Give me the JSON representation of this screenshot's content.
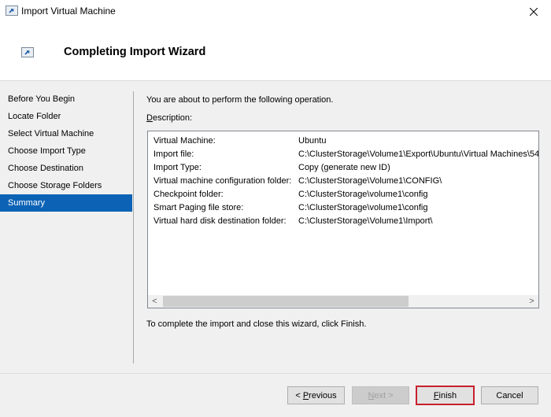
{
  "window": {
    "title": "Import Virtual Machine",
    "icon": "import-vm-icon",
    "close_icon": "close-icon"
  },
  "header": {
    "title": "Completing Import Wizard",
    "icon": "import-vm-icon"
  },
  "sidebar": {
    "items": [
      {
        "label": "Before You Begin",
        "active": false
      },
      {
        "label": "Locate Folder",
        "active": false
      },
      {
        "label": "Select Virtual Machine",
        "active": false
      },
      {
        "label": "Choose Import Type",
        "active": false
      },
      {
        "label": "Choose Destination",
        "active": false
      },
      {
        "label": "Choose Storage Folders",
        "active": false
      },
      {
        "label": "Summary",
        "active": true
      }
    ],
    "active_color": "#0c63b6"
  },
  "main": {
    "intro": "You are about to perform the following operation.",
    "description_label_accel": "D",
    "description_label_rest": "escription:",
    "description_rows": [
      {
        "key": "Virtual Machine:",
        "value": "Ubuntu"
      },
      {
        "key": "Import file:",
        "value": "C:\\ClusterStorage\\Volume1\\Export\\Ubuntu\\Virtual Machines\\54"
      },
      {
        "key": "Import Type:",
        "value": "Copy (generate new ID)"
      },
      {
        "key": "Virtual machine configuration folder:",
        "value": "C:\\ClusterStorage\\Volume1\\CONFIG\\"
      },
      {
        "key": "Checkpoint folder:",
        "value": "C:\\ClusterStorage\\volume1\\config"
      },
      {
        "key": "Smart Paging file store:",
        "value": "C:\\ClusterStorage\\volume1\\config"
      },
      {
        "key": "Virtual hard disk destination folder:",
        "value": "C:\\ClusterStorage\\Volume1\\Import\\"
      }
    ],
    "scroll_left_glyph": "<",
    "scroll_right_glyph": ">",
    "finish_instruction": "To complete the import and close this wizard, click Finish."
  },
  "buttons": {
    "previous": {
      "prefix": "< ",
      "accel": "P",
      "rest": "revious",
      "enabled": true
    },
    "next": {
      "accel": "N",
      "rest": "ext >",
      "enabled": false
    },
    "finish": {
      "accel": "F",
      "rest": "inish",
      "enabled": true,
      "highlight_color": "#c8202e"
    },
    "cancel": {
      "label": "Cancel",
      "enabled": true
    }
  }
}
